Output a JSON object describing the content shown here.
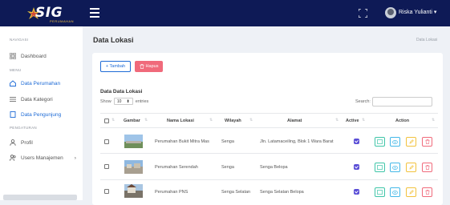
{
  "app": {
    "brand": "SIG",
    "brand_sub": "PERUMAHAN"
  },
  "topbar": {
    "user_name": "Riska Yulianti ▾"
  },
  "sidebar": {
    "section_nav": "NAVIGASI",
    "dashboard": "Dashboard",
    "section_menu": "MENU",
    "items": [
      {
        "label": "Data Perumahan"
      },
      {
        "label": "Data Kategori"
      },
      {
        "label": "Data Pengunjung"
      }
    ],
    "section_settings": "PENGATURAN",
    "profil": "Profil",
    "users": "Users Manajemen",
    "users_chevron": "›"
  },
  "page": {
    "title": "Data Lokasi",
    "breadcrumb": "Data Lokasi"
  },
  "toolbar": {
    "add_label": "+ Tambah",
    "delete_label": "Hapus",
    "delete_icon": "trash-icon"
  },
  "table": {
    "title": "Data Data Lokasi",
    "show_label": "Show",
    "show_value": "10",
    "entries_label": "entries",
    "search_label": "Search:",
    "columns": [
      "Gambar",
      "Nama Lokasi",
      "Wilayah",
      "Alamat",
      "Active",
      "Action"
    ],
    "rows": [
      {
        "name": "Perumahan Bukit Mitra Mas",
        "wilayah": "Senga",
        "alamat": "Jln. Latamaceiling, Blok 1 Wara Barat",
        "active": true
      },
      {
        "name": "Perumahan Serendah",
        "wilayah": "Senga",
        "alamat": "Senga Belopa",
        "active": true
      },
      {
        "name": "Perumahan PNS",
        "wilayah": "Senga Selatan",
        "alamat": "Senga Selatan Belopa",
        "active": true
      }
    ]
  },
  "colors": {
    "topbar": "#0e1a56",
    "accent": "#1e6bd6",
    "danger": "#f06a7b",
    "toggle": "#5b4fd6"
  }
}
